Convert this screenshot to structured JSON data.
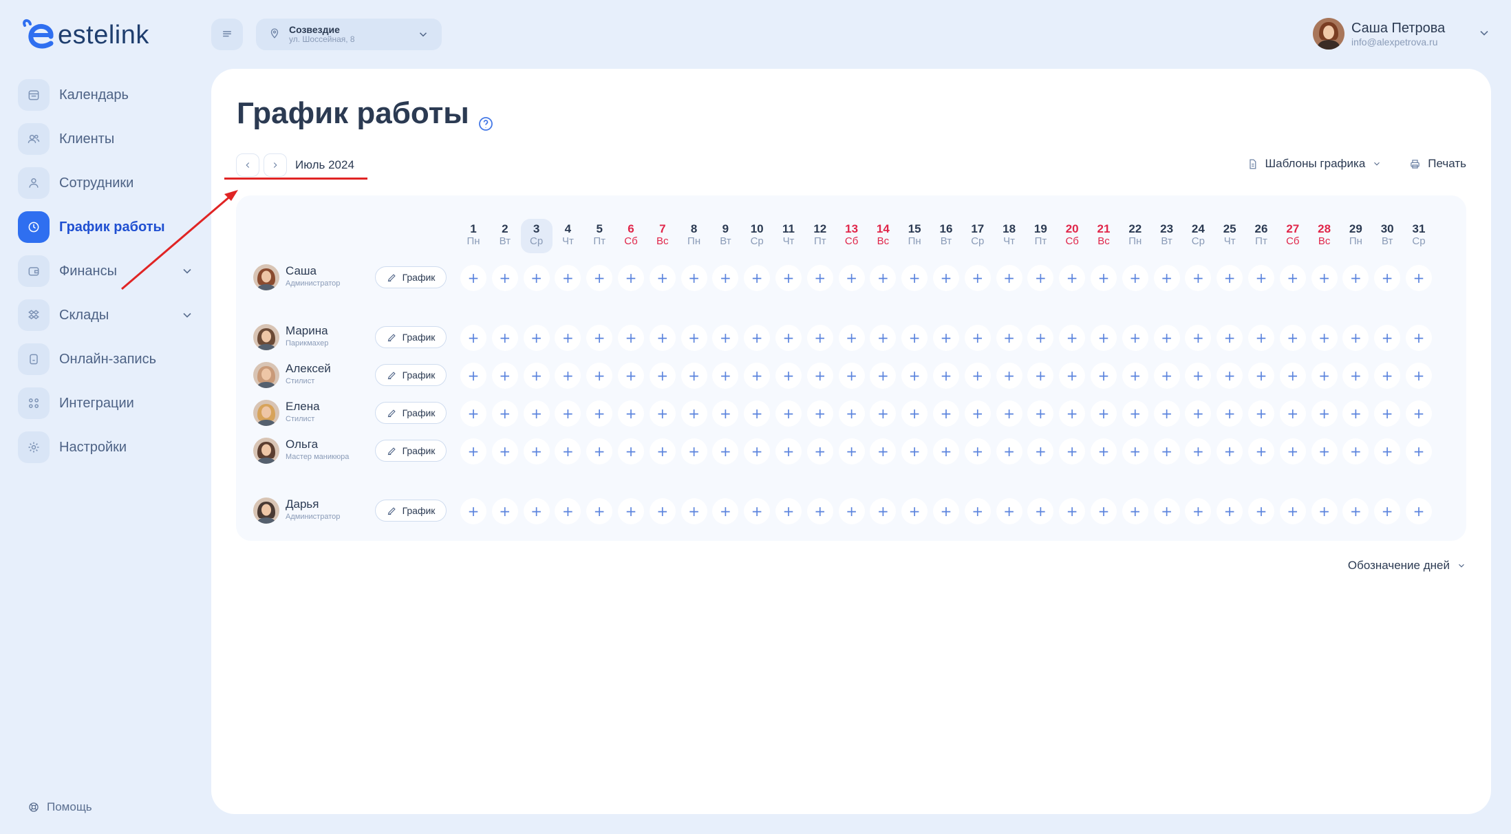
{
  "app": {
    "logo_text": "estelink"
  },
  "sidebar": {
    "items": [
      {
        "label": "Календарь",
        "icon": "calendar-icon"
      },
      {
        "label": "Клиенты",
        "icon": "clients-icon"
      },
      {
        "label": "Сотрудники",
        "icon": "user-icon"
      },
      {
        "label": "График работы",
        "icon": "clock-icon",
        "active": true
      },
      {
        "label": "Финансы",
        "icon": "wallet-icon",
        "expandable": true
      },
      {
        "label": "Склады",
        "icon": "stock-icon",
        "expandable": true
      },
      {
        "label": "Онлайн-запись",
        "icon": "phone-icon"
      },
      {
        "label": "Интеграции",
        "icon": "grid-icon"
      },
      {
        "label": "Настройки",
        "icon": "gear-icon"
      }
    ],
    "help_label": "Помощь"
  },
  "topbar": {
    "location_name": "Созвездие",
    "location_address": "ул. Шоссейная, 8",
    "user_name": "Саша Петрова",
    "user_email": "info@alexpetrova.ru"
  },
  "page": {
    "title": "График работы",
    "month_label": "Июль 2024",
    "templates_label": "Шаблоны графика",
    "print_label": "Печать",
    "legend_label": "Обозначение дней",
    "schedule_button_label": "График",
    "add_symbol": "+"
  },
  "days": [
    {
      "num": "1",
      "dow": "Пн"
    },
    {
      "num": "2",
      "dow": "Вт"
    },
    {
      "num": "3",
      "dow": "Ср",
      "today": true
    },
    {
      "num": "4",
      "dow": "Чт"
    },
    {
      "num": "5",
      "dow": "Пт"
    },
    {
      "num": "6",
      "dow": "Сб",
      "weekend": true
    },
    {
      "num": "7",
      "dow": "Вс",
      "weekend": true
    },
    {
      "num": "8",
      "dow": "Пн"
    },
    {
      "num": "9",
      "dow": "Вт"
    },
    {
      "num": "10",
      "dow": "Ср"
    },
    {
      "num": "11",
      "dow": "Чт"
    },
    {
      "num": "12",
      "dow": "Пт"
    },
    {
      "num": "13",
      "dow": "Сб",
      "weekend": true
    },
    {
      "num": "14",
      "dow": "Вс",
      "weekend": true
    },
    {
      "num": "15",
      "dow": "Пн"
    },
    {
      "num": "16",
      "dow": "Вт"
    },
    {
      "num": "17",
      "dow": "Ср"
    },
    {
      "num": "18",
      "dow": "Чт"
    },
    {
      "num": "19",
      "dow": "Пт"
    },
    {
      "num": "20",
      "dow": "Сб",
      "weekend": true
    },
    {
      "num": "21",
      "dow": "Вс",
      "weekend": true
    },
    {
      "num": "22",
      "dow": "Пн"
    },
    {
      "num": "23",
      "dow": "Вт"
    },
    {
      "num": "24",
      "dow": "Ср"
    },
    {
      "num": "25",
      "dow": "Чт"
    },
    {
      "num": "26",
      "dow": "Пт"
    },
    {
      "num": "27",
      "dow": "Сб",
      "weekend": true
    },
    {
      "num": "28",
      "dow": "Вс",
      "weekend": true
    },
    {
      "num": "29",
      "dow": "Пн"
    },
    {
      "num": "30",
      "dow": "Вт"
    },
    {
      "num": "31",
      "dow": "Ср"
    }
  ],
  "employees": [
    {
      "name": "Саша",
      "role": "Администратор",
      "avatar_color": "#8a4b2f"
    },
    {
      "name": "Марина",
      "role": "Парикмахер",
      "avatar_color": "#6b4a36"
    },
    {
      "name": "Алексей",
      "role": "Стилист",
      "avatar_color": "#c99a78"
    },
    {
      "name": "Елена",
      "role": "Стилист",
      "avatar_color": "#d7a35a"
    },
    {
      "name": "Ольга",
      "role": "Мастер маникюра",
      "avatar_color": "#5b3e30"
    },
    {
      "name": "Дарья",
      "role": "Администратор",
      "avatar_color": "#4a3a33"
    }
  ],
  "colors": {
    "accent": "#2f6ff0",
    "weekend": "#e0264a",
    "annotation": "#e02424"
  }
}
